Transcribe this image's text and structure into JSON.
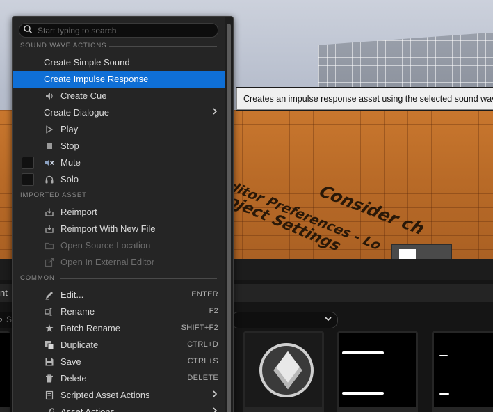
{
  "viewport": {
    "floor_text": [
      "Consider ch",
      "ditor Preferences - Lo",
      "oject Settings"
    ]
  },
  "browser": {
    "path_fragment": "nt",
    "search_fragment": "S"
  },
  "context_menu": {
    "search": {
      "placeholder": "Start typing to search"
    },
    "sections": {
      "sound_wave_actions": "SOUND WAVE ACTIONS",
      "imported_asset": "IMPORTED ASSET",
      "common": "COMMON"
    },
    "items": {
      "create_simple_sound": "Create Simple Sound",
      "create_impulse_response": "Create Impulse Response",
      "create_cue": "Create Cue",
      "create_dialogue": "Create Dialogue",
      "play": "Play",
      "stop": "Stop",
      "mute": "Mute",
      "solo": "Solo",
      "reimport": "Reimport",
      "reimport_new_file": "Reimport With New File",
      "open_source_location": "Open Source Location",
      "open_external_editor": "Open In External Editor",
      "edit": "Edit...",
      "rename": "Rename",
      "batch_rename": "Batch Rename",
      "duplicate": "Duplicate",
      "save": "Save",
      "delete": "Delete",
      "scripted_asset_actions": "Scripted Asset Actions",
      "asset_actions": "Asset Actions"
    },
    "shortcuts": {
      "edit": "ENTER",
      "rename": "F2",
      "batch_rename": "SHIFT+F2",
      "duplicate": "CTRL+D",
      "save": "CTRL+S",
      "delete": "DELETE"
    },
    "mute_checked": false,
    "solo_checked": false
  },
  "tooltip": {
    "text": "Creates an impulse response asset using the selected sound wave."
  },
  "colors": {
    "highlight": "#0f6fd6",
    "menu_bg": "#252525",
    "tile_bar_green": "#3ec43e",
    "tile_bar_purple": "#6a5acd"
  }
}
